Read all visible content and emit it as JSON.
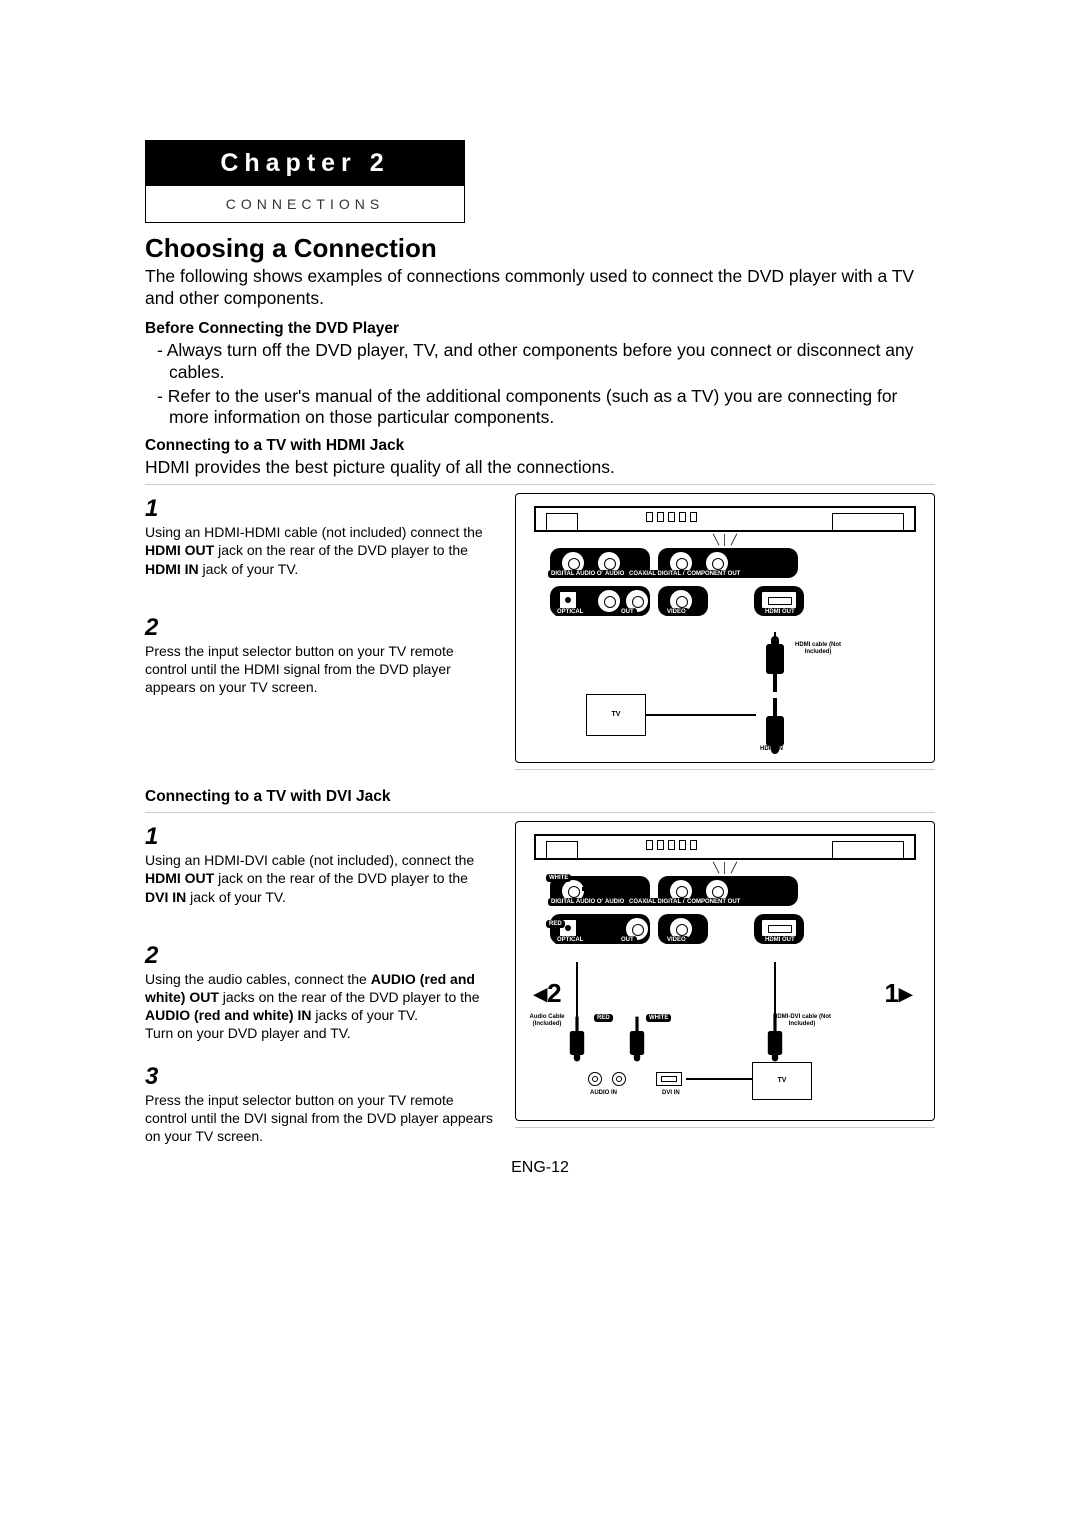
{
  "chapter": {
    "prefix": "Chapter",
    "num": "2",
    "subtitle": "CONNECTIONS"
  },
  "title": "Choosing a Connection",
  "intro": "The following shows examples of connections commonly used to connect the DVD player with a TV and other components.",
  "before": {
    "heading": "Before Connecting the DVD Player",
    "b1": "Always turn off the DVD player, TV, and other components before you connect or disconnect any cables.",
    "b2": "Refer to the user's manual of the additional components (such as a TV) you are connecting for more information on those particular components."
  },
  "hdmi": {
    "heading": "Connecting to a TV with HDMI Jack",
    "lead": "HDMI provides the best picture quality of all the connections.",
    "s1n": "1",
    "s1a": "Using an HDMI-HDMI cable (not included) connect the ",
    "s1b": "HDMI OUT",
    "s1c": " jack on the rear of the DVD player to the ",
    "s1d": "HDMI IN",
    "s1e": " jack of your TV.",
    "s2n": "2",
    "s2": "Press the input selector button on your TV remote control until the HDMI signal from the DVD player appears on your TV screen."
  },
  "dvi": {
    "heading": "Connecting to a TV with DVI Jack",
    "s1n": "1",
    "s1a": "Using an HDMI-DVI cable (not included), connect the ",
    "s1b": "HDMI OUT",
    "s1c": " jack on the rear of the DVD player to the ",
    "s1d": "DVI IN ",
    "s1e": " jack of your TV.",
    "s2n": "2",
    "s2a": "Using the audio cables, connect the ",
    "s2b": "AUDIO (red and white) OUT",
    "s2c": " jacks on the rear of the DVD player to the ",
    "s2d": "AUDIO (red and white) IN",
    "s2e": " jacks of your TV.",
    "s2f": "Turn on your DVD player and TV.",
    "s3n": "3",
    "s3": "Press the input selector button on your TV remote control until the DVI signal from the DVD player appears on your TV screen."
  },
  "diagramLabels": {
    "digitalAudioOut": "DIGITAL AUDIO OUT",
    "audio": "AUDIO",
    "coaxial": "COAXIAL DIGITAL AUDIO OUT",
    "componentOut": "COMPONENT OUT",
    "optical": "OPTICAL",
    "out": "OUT",
    "video": "VIDEO",
    "hdmiOut": "HDMI OUT",
    "hdmiCable": "HDMI cable (Not Included)",
    "hdmiDviCable": "HDMI-DVI cable (Not Included)",
    "tv": "TV",
    "hdmiIn": "HDMI IN",
    "audioCable": "Audio Cable (Included)",
    "red": "RED",
    "white": "WHITE",
    "audioIn": "AUDIO IN",
    "dviIn": "DVI IN",
    "bigOne": "1",
    "bigTwo": "2",
    "triOne": "▸",
    "triTwo": "◂"
  },
  "footer": "ENG-12"
}
